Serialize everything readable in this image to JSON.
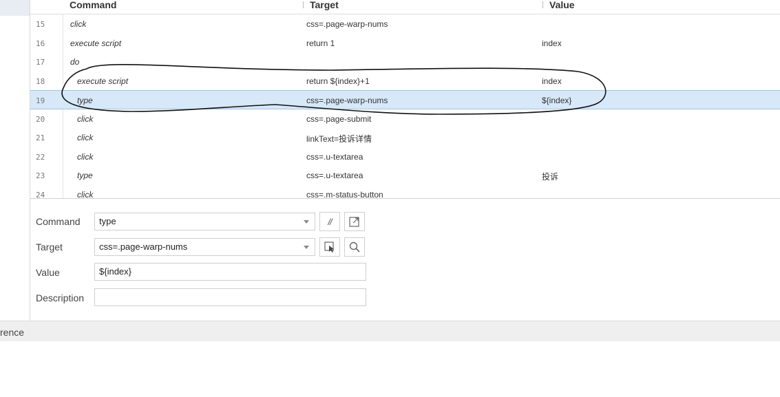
{
  "columns": {
    "command": "Command",
    "target": "Target",
    "value": "Value"
  },
  "rows": [
    {
      "num": "15",
      "command": "click",
      "target": "css=.page-warp-nums",
      "value": "",
      "indent": 0
    },
    {
      "num": "16",
      "command": "execute script",
      "target": "return 1",
      "value": "index",
      "indent": 0
    },
    {
      "num": "17",
      "command": "do",
      "target": "",
      "value": "",
      "indent": 0
    },
    {
      "num": "18",
      "command": "execute script",
      "target": "return ${index}+1",
      "value": "index",
      "indent": 1
    },
    {
      "num": "19",
      "command": "type",
      "target": "css=.page-warp-nums",
      "value": "${index}",
      "indent": 1,
      "selected": true
    },
    {
      "num": "20",
      "command": "click",
      "target": "css=.page-submit",
      "value": "",
      "indent": 1
    },
    {
      "num": "21",
      "command": "click",
      "target": "linkText=投诉详情",
      "value": "",
      "indent": 1
    },
    {
      "num": "22",
      "command": "click",
      "target": "css=.u-textarea",
      "value": "",
      "indent": 1
    },
    {
      "num": "23",
      "command": "type",
      "target": "css=.u-textarea",
      "value": "投诉",
      "indent": 1
    },
    {
      "num": "24",
      "command": "click",
      "target": "css=.m-status-button",
      "value": "",
      "indent": 1
    }
  ],
  "editor": {
    "command_label": "Command",
    "command_value": "type",
    "comment_button": "//",
    "target_label": "Target",
    "target_value": "css=.page-warp-nums",
    "value_label": "Value",
    "value_value": "${index}",
    "description_label": "Description",
    "description_value": ""
  },
  "icons": {
    "open_reference": "open-in-new-window-icon",
    "select_target": "select-target-in-page-icon",
    "find_target": "magnifier-icon"
  },
  "footer": {
    "tab_text": "rence"
  },
  "colors": {
    "selected_row": "#d7e8f8",
    "selected_border": "#9ec3e6"
  }
}
